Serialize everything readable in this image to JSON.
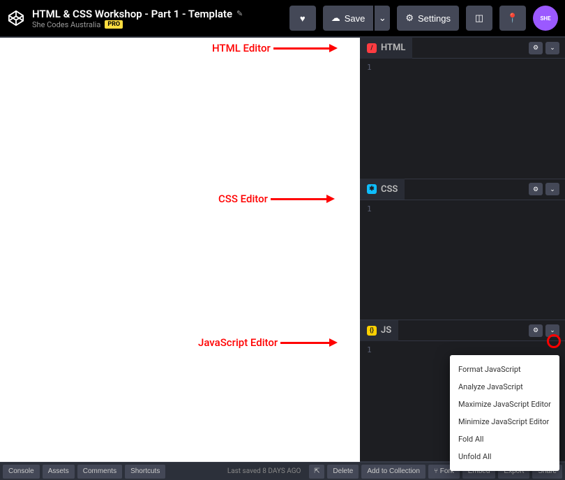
{
  "header": {
    "title": "HTML & CSS Workshop - Part 1 - Template",
    "author": "She Codes Australia",
    "pro": "PRO",
    "save": "Save",
    "settings": "Settings",
    "avatar": "SHE"
  },
  "editors": {
    "html": {
      "name": "HTML",
      "line": "1"
    },
    "css": {
      "name": "CSS",
      "line": "1"
    },
    "js": {
      "name": "JS",
      "line": "1"
    }
  },
  "dropdown": {
    "items": [
      "Format JavaScript",
      "Analyze JavaScript",
      "Maximize JavaScript Editor",
      "Minimize JavaScript Editor",
      "Fold All",
      "Unfold All"
    ]
  },
  "footer": {
    "left": [
      "Console",
      "Assets",
      "Comments",
      "Shortcuts"
    ],
    "saved": "Last saved 8 DAYS AGO",
    "right": [
      "Delete",
      "Add to Collection",
      "Fork",
      "Embed",
      "Export",
      "Share"
    ]
  },
  "annotations": {
    "html": "HTML Editor",
    "css": "CSS Editor",
    "js": "JavaScript Editor"
  }
}
